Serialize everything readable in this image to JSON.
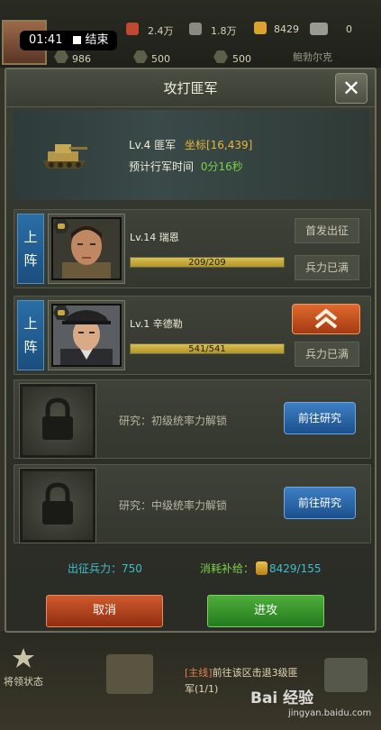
{
  "status_bar": {
    "time": "01:41",
    "end_label": "结束"
  },
  "resources": [
    {
      "name": "food",
      "value": "2.4万",
      "icon": "fuel-can-icon",
      "color": "#c04830"
    },
    {
      "name": "steel",
      "value": "1.8万",
      "icon": "steel-icon",
      "color": "#8a8a80"
    },
    {
      "name": "supply",
      "value": "8429",
      "icon": "coin-stack-icon",
      "color": "#d9a330"
    },
    {
      "name": "extra",
      "value": "0",
      "icon": "truck-icon",
      "color": "#9a9a90"
    }
  ],
  "troops": [
    {
      "value": "986"
    },
    {
      "value": "500"
    },
    {
      "value": "500"
    }
  ],
  "ally_label": "鲍勃尔克",
  "dialog": {
    "title": "攻打匪军",
    "close_symbol": "✕",
    "target": {
      "name": "Lv.4 匪军",
      "coord_prefix": "坐标",
      "coord": "[16,439]",
      "march_label": "预计行军时间",
      "march_time": "0分16秒"
    },
    "slots": [
      {
        "tag": "上阵",
        "hero": "Lv.14 瑞恩",
        "troops": "209/209",
        "fill": 1.0,
        "buttons": [
          "首发出征",
          "兵力已满"
        ]
      },
      {
        "tag": "上阵",
        "hero": "Lv.1 辛德勒",
        "troops": "541/541",
        "fill": 1.0,
        "buttons": [
          "兵力已满"
        ]
      }
    ],
    "locked_slots": [
      {
        "text": "研究：初级统率力解锁",
        "button": "前往研究"
      },
      {
        "text": "研究：中级统率力解锁",
        "button": "前往研究"
      }
    ],
    "summary": {
      "troops_label": "出征兵力：",
      "troops_value": "750",
      "supply_label": "消耗补给：",
      "supply_value": "8429/155"
    },
    "cancel_label": "取消",
    "attack_label": "进攻"
  },
  "bottom": {
    "general_status": "将领状态",
    "quest_line1_tag": "[主线]",
    "quest_line1_rest": "前往该区击退3级匪",
    "quest_line2": "军(1/1)"
  },
  "watermark": {
    "brand": "Bai 经验",
    "url": "jingyan.baidu.com"
  }
}
